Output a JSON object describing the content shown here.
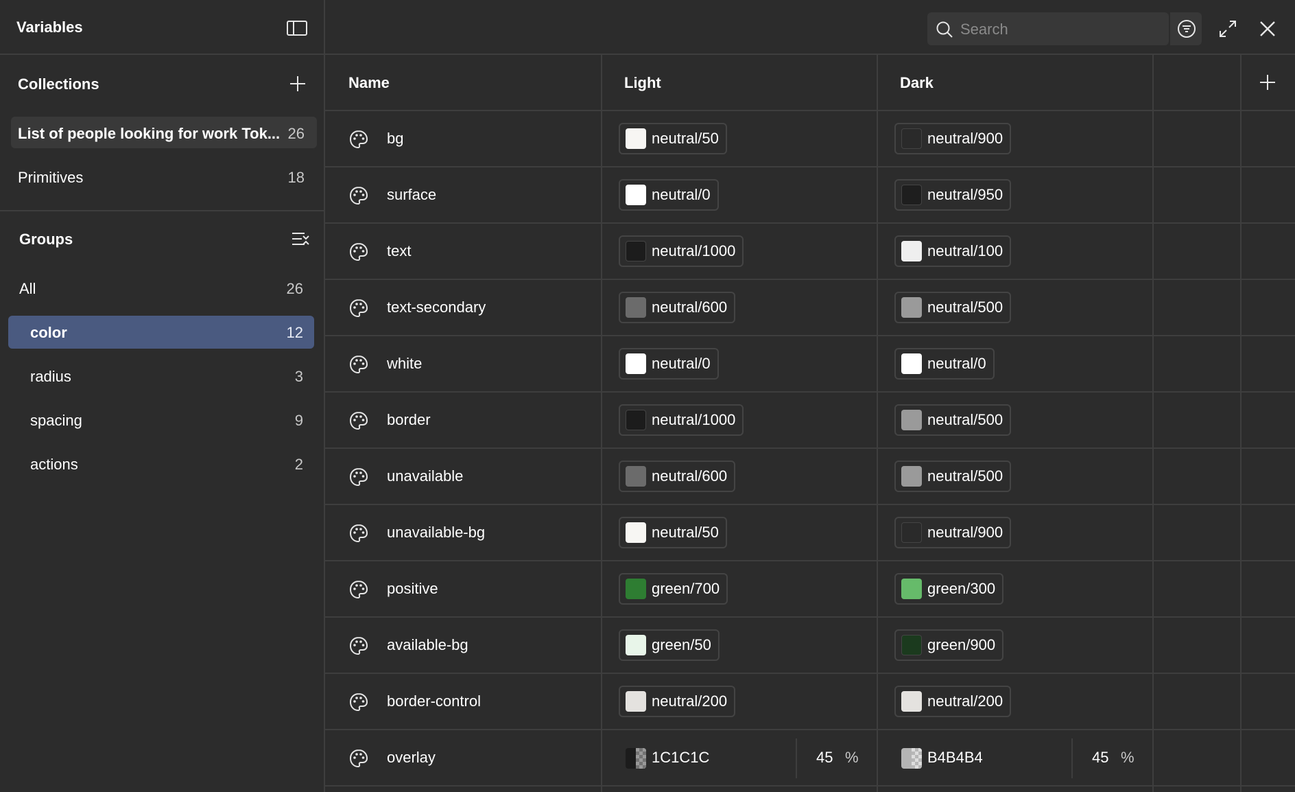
{
  "sidebar": {
    "title": "Variables",
    "collections": {
      "heading": "Collections",
      "items": [
        {
          "label": "List of people looking for work Tok...",
          "count": "26",
          "active": true
        },
        {
          "label": "Primitives",
          "count": "18",
          "active": false
        }
      ]
    },
    "groups": {
      "heading": "Groups",
      "items": [
        {
          "label": "All",
          "count": "26",
          "active": false
        },
        {
          "label": "color",
          "count": "12",
          "active": true
        },
        {
          "label": "radius",
          "count": "3",
          "active": false
        },
        {
          "label": "spacing",
          "count": "9",
          "active": false
        },
        {
          "label": "actions",
          "count": "2",
          "active": false
        }
      ]
    }
  },
  "toolbar": {
    "search_placeholder": "Search"
  },
  "table": {
    "columns": {
      "name": "Name",
      "light": "Light",
      "dark": "Dark"
    },
    "rows": [
      {
        "name": "bg",
        "light": {
          "label": "neutral/50",
          "color": "#f7f6f3"
        },
        "dark": {
          "label": "neutral/900",
          "color": "#2a2a2a"
        }
      },
      {
        "name": "surface",
        "light": {
          "label": "neutral/0",
          "color": "#ffffff"
        },
        "dark": {
          "label": "neutral/950",
          "color": "#1e1e1e"
        }
      },
      {
        "name": "text",
        "light": {
          "label": "neutral/1000",
          "color": "#1c1c1c"
        },
        "dark": {
          "label": "neutral/100",
          "color": "#efefef"
        }
      },
      {
        "name": "text-secondary",
        "light": {
          "label": "neutral/600",
          "color": "#6b6b6b"
        },
        "dark": {
          "label": "neutral/500",
          "color": "#9a9a9a"
        }
      },
      {
        "name": "white",
        "light": {
          "label": "neutral/0",
          "color": "#ffffff"
        },
        "dark": {
          "label": "neutral/0",
          "color": "#ffffff"
        }
      },
      {
        "name": "border",
        "light": {
          "label": "neutral/1000",
          "color": "#1c1c1c"
        },
        "dark": {
          "label": "neutral/500",
          "color": "#9a9a9a"
        }
      },
      {
        "name": "unavailable",
        "light": {
          "label": "neutral/600",
          "color": "#6b6b6b"
        },
        "dark": {
          "label": "neutral/500",
          "color": "#9a9a9a"
        }
      },
      {
        "name": "unavailable-bg",
        "light": {
          "label": "neutral/50",
          "color": "#f7f6f3"
        },
        "dark": {
          "label": "neutral/900",
          "color": "#2a2a2a"
        }
      },
      {
        "name": "positive",
        "light": {
          "label": "green/700",
          "color": "#2e7d32"
        },
        "dark": {
          "label": "green/300",
          "color": "#66bb6a"
        }
      },
      {
        "name": "available-bg",
        "light": {
          "label": "green/50",
          "color": "#e8f5e9"
        },
        "dark": {
          "label": "green/900",
          "color": "#1b3a1e"
        }
      },
      {
        "name": "border-control",
        "light": {
          "label": "neutral/200",
          "color": "#e4e2df"
        },
        "dark": {
          "label": "neutral/200",
          "color": "#e4e2df"
        }
      }
    ],
    "overlay_row": {
      "name": "overlay",
      "light": {
        "hex": "1C1C1C",
        "alpha": "45",
        "unit": "%",
        "color": "#1c1c1c"
      },
      "dark": {
        "hex": "B4B4B4",
        "alpha": "45",
        "unit": "%",
        "color": "#b4b4b4"
      }
    }
  }
}
